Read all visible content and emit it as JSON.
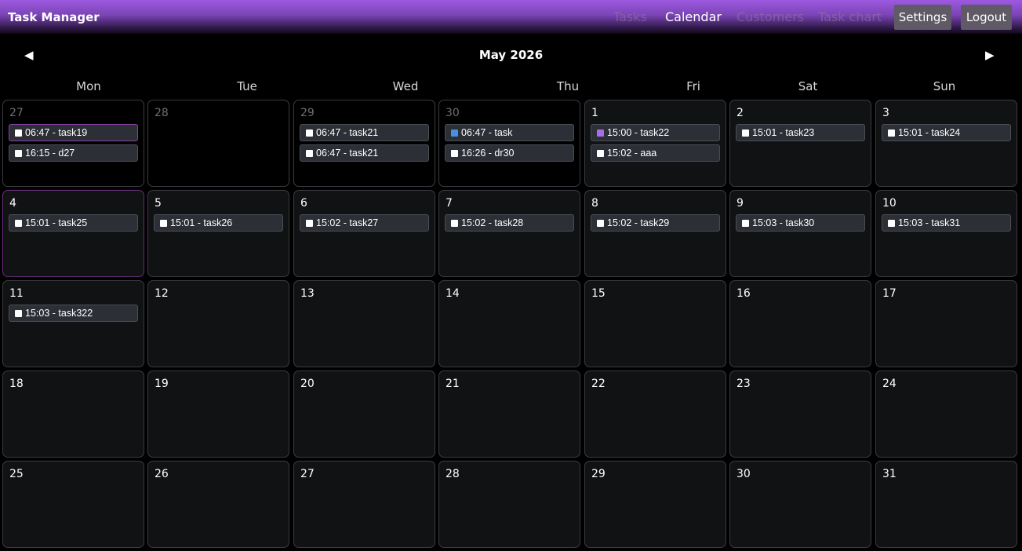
{
  "header": {
    "title": "Task Manager",
    "nav": [
      "Tasks",
      "Calendar",
      "Customers",
      "Task chart"
    ],
    "settings_label": "Settings",
    "logout_label": "Logout"
  },
  "calendar": {
    "month_title": "May 2026",
    "prev_arrow": "◀",
    "next_arrow": "▶",
    "weekdays": [
      "Mon",
      "Tue",
      "Wed",
      "Thu",
      "Fri",
      "Sat",
      "Sun"
    ],
    "weeks": [
      [
        {
          "day": "27",
          "other": true,
          "events": [
            {
              "label": "06:47 - task19",
              "highlight": true
            },
            {
              "label": "16:15 - d27"
            }
          ]
        },
        {
          "day": "28",
          "other": true,
          "events": []
        },
        {
          "day": "29",
          "other": true,
          "events": [
            {
              "label": "06:47 - task21"
            },
            {
              "label": "06:47 - task21"
            }
          ]
        },
        {
          "day": "30",
          "other": true,
          "events": [
            {
              "label": "06:47 - task",
              "color": "#4a90e2"
            },
            {
              "label": "16:26 - dr30"
            }
          ]
        },
        {
          "day": "1",
          "events": [
            {
              "label": "15:00 - task22",
              "color": "#a86ee8"
            },
            {
              "label": "15:02 - aaa"
            }
          ]
        },
        {
          "day": "2",
          "events": [
            {
              "label": "15:01 - task23"
            }
          ]
        },
        {
          "day": "3",
          "events": [
            {
              "label": "15:01 - task24"
            }
          ]
        }
      ],
      [
        {
          "day": "4",
          "today": true,
          "events": [
            {
              "label": "15:01 - task25"
            }
          ]
        },
        {
          "day": "5",
          "events": [
            {
              "label": "15:01 - task26"
            }
          ]
        },
        {
          "day": "6",
          "events": [
            {
              "label": "15:02 - task27"
            }
          ]
        },
        {
          "day": "7",
          "events": [
            {
              "label": "15:02 - task28"
            }
          ]
        },
        {
          "day": "8",
          "events": [
            {
              "label": "15:02 - task29"
            }
          ]
        },
        {
          "day": "9",
          "events": [
            {
              "label": "15:03 - task30"
            }
          ]
        },
        {
          "day": "10",
          "events": [
            {
              "label": "15:03 - task31"
            }
          ]
        }
      ],
      [
        {
          "day": "11",
          "events": [
            {
              "label": "15:03 - task322"
            }
          ]
        },
        {
          "day": "12",
          "events": []
        },
        {
          "day": "13",
          "events": []
        },
        {
          "day": "14",
          "events": []
        },
        {
          "day": "15",
          "events": []
        },
        {
          "day": "16",
          "events": []
        },
        {
          "day": "17",
          "events": []
        }
      ],
      [
        {
          "day": "18",
          "events": []
        },
        {
          "day": "19",
          "events": []
        },
        {
          "day": "20",
          "events": []
        },
        {
          "day": "21",
          "events": []
        },
        {
          "day": "22",
          "events": []
        },
        {
          "day": "23",
          "events": []
        },
        {
          "day": "24",
          "events": []
        }
      ],
      [
        {
          "day": "25",
          "events": []
        },
        {
          "day": "26",
          "events": []
        },
        {
          "day": "27",
          "events": []
        },
        {
          "day": "28",
          "events": []
        },
        {
          "day": "29",
          "events": []
        },
        {
          "day": "30",
          "events": []
        },
        {
          "day": "31",
          "events": []
        }
      ]
    ]
  }
}
